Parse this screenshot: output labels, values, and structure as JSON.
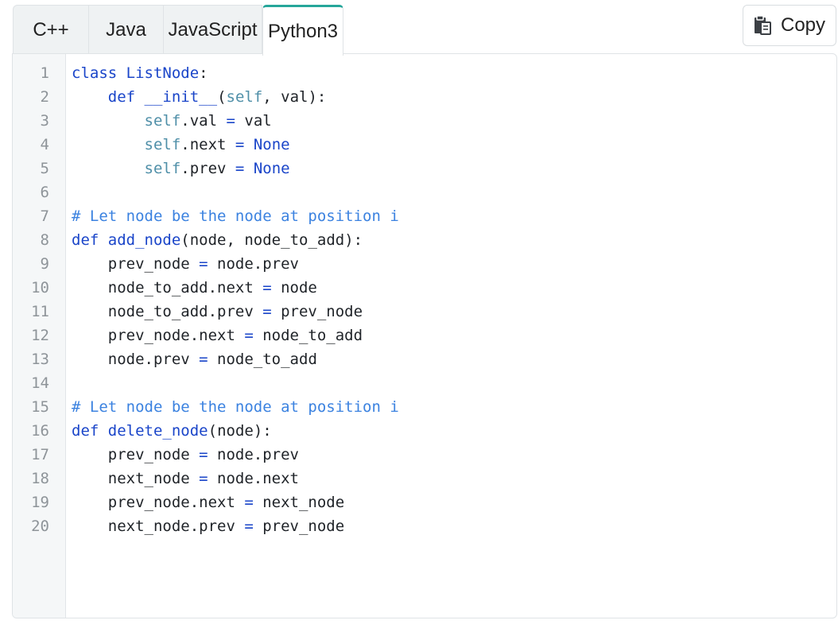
{
  "tabs": [
    {
      "label": "C++",
      "active": false
    },
    {
      "label": "Java",
      "active": false
    },
    {
      "label": "JavaScript",
      "active": false
    },
    {
      "label": "Python3",
      "active": true
    }
  ],
  "copy_button": {
    "label": "Copy",
    "icon": "clipboard-icon"
  },
  "colors": {
    "active_tab_accent": "#26a69a",
    "keyword": "#1a45c9",
    "self": "#4f8fa8",
    "comment": "#3b82e0",
    "line_number": "#8e9499"
  },
  "code": {
    "language": "Python3",
    "lines": [
      "class ListNode:",
      "    def __init__(self, val):",
      "        self.val = val",
      "        self.next = None",
      "        self.prev = None",
      "",
      "# Let node be the node at position i",
      "def add_node(node, node_to_add):",
      "    prev_node = node.prev",
      "    node_to_add.next = node",
      "    node_to_add.prev = prev_node",
      "    prev_node.next = node_to_add",
      "    node.prev = node_to_add",
      "",
      "# Let node be the node at position i",
      "def delete_node(node):",
      "    prev_node = node.prev",
      "    next_node = node.next",
      "    prev_node.next = next_node",
      "    next_node.prev = prev_node"
    ]
  }
}
